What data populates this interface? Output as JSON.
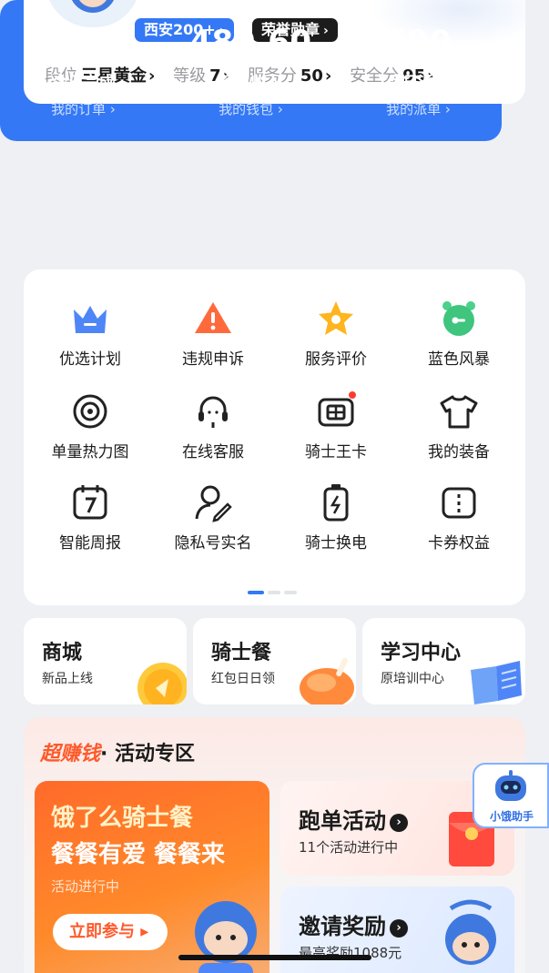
{
  "profile": {
    "city_badge": "西安200+",
    "honor_badge": "荣誉勋章",
    "stats": [
      {
        "key": "段位",
        "value": "三星黄金"
      },
      {
        "key": "等级",
        "value": "7"
      },
      {
        "key": "服务分",
        "value": "50"
      },
      {
        "key": "安全分",
        "value": "95"
      }
    ]
  },
  "today": [
    {
      "num": "43",
      "label": "今日完成",
      "link": "我的订单"
    },
    {
      "num": "480.60",
      "label": "今日收入",
      "link": "我的钱包"
    },
    {
      "num": "690",
      "label": "今日派单",
      "link": "我的派单"
    }
  ],
  "grid": [
    {
      "label": "优选计划",
      "icon": "crown-icon"
    },
    {
      "label": "违规申诉",
      "icon": "warning-icon"
    },
    {
      "label": "服务评价",
      "icon": "star-icon"
    },
    {
      "label": "蓝色风暴",
      "icon": "clock-icon"
    },
    {
      "label": "单量热力图",
      "icon": "target-icon"
    },
    {
      "label": "在线客服",
      "icon": "headset-icon"
    },
    {
      "label": "骑士王卡",
      "icon": "card-icon"
    },
    {
      "label": "我的装备",
      "icon": "tshirt-icon"
    },
    {
      "label": "智能周报",
      "icon": "calendar-icon"
    },
    {
      "label": "隐私号实名",
      "icon": "user-edit-icon"
    },
    {
      "label": "骑士换电",
      "icon": "battery-icon"
    },
    {
      "label": "卡券权益",
      "icon": "coupon-icon"
    }
  ],
  "promos": [
    {
      "title": "商城",
      "sub": "新品上线",
      "art": "coin-art"
    },
    {
      "title": "骑士餐",
      "sub": "红包日日领",
      "art": "chicken-art"
    },
    {
      "title": "学习中心",
      "sub": "原培训中心",
      "art": "book-art"
    }
  ],
  "activity": {
    "title_hot": "超赚钱",
    "title": "· 活动专区",
    "big": {
      "line1": "饿了么骑士餐",
      "line2": "餐餐有爱 餐餐来",
      "status": "活动进行中",
      "button": "立即参与"
    },
    "run": {
      "title": "跑单活动",
      "sub": "11个活动进行中"
    },
    "invite": {
      "title": "邀请奖励",
      "sub": "最高奖励1088元"
    }
  },
  "assistant": {
    "label": "小饿助手"
  },
  "colors": {
    "primary": "#3478f6",
    "accent": "#ff5a2b",
    "bg": "#eef0f4"
  }
}
